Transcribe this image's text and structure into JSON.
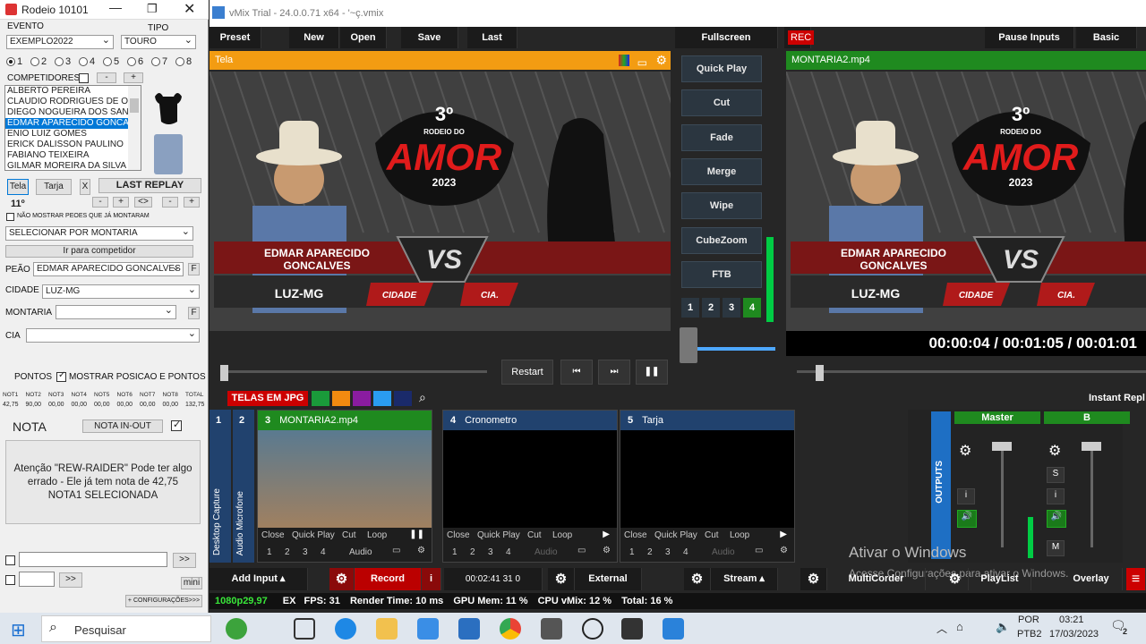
{
  "left_app": {
    "title": "Rodeio 10101",
    "evento_label": "EVENTO",
    "evento_value": "EXEMPLO2022",
    "tipo_label": "TIPO",
    "tipo_value": "TOURO",
    "radios": [
      "1",
      "2",
      "3",
      "4",
      "5",
      "6",
      "7",
      "8"
    ],
    "competidores_label": "COMPETIDORES",
    "competitors": [
      "ALBERTO PEREIRA",
      "CLAUDIO RODRIGUES DE OLI",
      "DIEGO NOGUEIRA DOS SANTO",
      "EDMAR APARECIDO GONCALV",
      "ENIO LUIZ GOMES",
      "ERICK DALISSON PAULINO",
      "FABIANO TEIXEIRA",
      "GILMAR MOREIRA DA SILVA"
    ],
    "btn_tela": "Tela",
    "btn_tarja": "Tarja",
    "btn_x": "X",
    "btn_last_replay": "LAST REPLAY",
    "rank": "11º",
    "nao_mostrar": "NÃO MOSTRAR PEOES QUE JÁ MONTARAM",
    "selecionar": "SELECIONAR POR MONTARIA",
    "ir_para": "Ir para competidor",
    "peao_label": "PEÃO",
    "peao_value": "EDMAR APARECIDO GONCALVES",
    "cidade_label": "CIDADE",
    "cidade_value": "LUZ-MG",
    "montaria_label": "MONTARIA",
    "cia_label": "CIA",
    "f": "F",
    "pontos_label": "PONTOS",
    "mostrar_posicao": "MOSTRAR POSICAO E PONTOS",
    "notas_headers": [
      "NOT1",
      "NOT2",
      "NOT3",
      "NOT4",
      "NOT5",
      "NOT6",
      "NOT7",
      "NOT8",
      "TOTAL"
    ],
    "notas_values": [
      "42,75",
      "90,00",
      "00,00",
      "00,00",
      "00,00",
      "00,00",
      "00,00",
      "00,00",
      "132,75"
    ],
    "nota_label": "NOTA",
    "nota_inout": "NOTA IN-OUT",
    "message": "Atenção \"REW-RAIDER\" Pode ter algo errado - Ele já tem nota de 42,75 NOTA1 SELECIONADA",
    "arrow_btn": ">>",
    "mini": "mini",
    "config": "+ CONFIGURAÇÕES>>>"
  },
  "vmix": {
    "title": "vMix Trial - 24.0.0.71 x64 - '~ç.vmix",
    "menu": [
      "Preset",
      "New",
      "Open",
      "Save",
      "Last"
    ],
    "fullscreen": "Fullscreen",
    "rec": "REC",
    "pause_inputs": "Pause Inputs",
    "basic": "Basic",
    "preview_label": "Tela",
    "program_label": "MONTARIA2.mp4",
    "transitions": [
      "Quick Play",
      "Cut",
      "Fade",
      "Merge",
      "Wipe",
      "CubeZoom",
      "FTB"
    ],
    "trans_nums": [
      "1",
      "2",
      "3",
      "4"
    ],
    "overlay": {
      "rodeio_num": "3º",
      "rodeio_do": "RODEIO DO",
      "amor": "AMOR",
      "year": "2023",
      "name": "EDMAR APARECIDO GONCALVES",
      "vs": "VS",
      "city": "LUZ-MG",
      "cidade": "CIDADE",
      "cia": "CIA."
    },
    "timecode": "00:00:04 / 00:01:05 / 00:01:01",
    "restart": "Restart",
    "telas_tab": "TELAS EM JPG",
    "instant_replay": "Instant Repl",
    "side_labels": [
      "Desktop Capture",
      "Audio Microfone"
    ],
    "inputs": [
      {
        "num": "3",
        "name": "MONTARIA2.mp4",
        "color": "#1f8a1f"
      },
      {
        "num": "4",
        "name": "Cronometro",
        "color": "#21426e"
      },
      {
        "num": "5",
        "name": "Tarja",
        "color": "#21426e"
      }
    ],
    "input_ctrl": [
      "Close",
      "Quick Play",
      "Cut",
      "Loop"
    ],
    "audio": "Audio",
    "outputs": "OUTPUTS",
    "master": "Master",
    "b": "B",
    "bottom": {
      "add_input": "Add Input",
      "record": "Record",
      "time": "00:02:41 31 0",
      "external": "External",
      "stream": "Stream",
      "multicorder": "MultiCorder",
      "playlist": "PlayList",
      "overlay": "Overlay"
    },
    "status": {
      "format": "1080p29,97",
      "ex": "EX",
      "fps": "FPS:  31",
      "render": "Render Time:  10 ms",
      "gpu": "GPU Mem:  11 %",
      "cpu": "CPU vMix:  12 %",
      "total": "Total:  16 %"
    },
    "watermark1": "Ativar o Windows",
    "watermark2": "Acesse Configurações para ativar o Windows."
  },
  "taskbar": {
    "search": "Pesquisar",
    "lang": "POR",
    "lang2": "PTB2",
    "time": "03:21",
    "date": "17/03/2023",
    "notif": "2"
  }
}
